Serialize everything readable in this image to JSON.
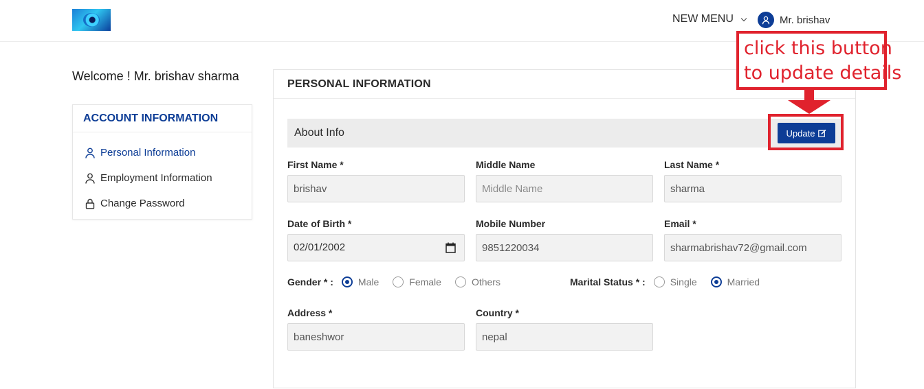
{
  "header": {
    "menu_label": "NEW MENU",
    "user_name": "Mr. brishav"
  },
  "annotation": {
    "line1": "click this button",
    "line2": "to update details",
    "color": "#e0222d"
  },
  "sidebar": {
    "welcome": "Welcome ! Mr. brishav sharma",
    "card_title": "ACCOUNT INFORMATION",
    "items": [
      {
        "label": "Personal Information",
        "icon": "user-icon",
        "active": true
      },
      {
        "label": "Employment Information",
        "icon": "user-icon",
        "active": false
      },
      {
        "label": "Change Password",
        "icon": "lock-icon",
        "active": false
      }
    ]
  },
  "panel": {
    "title": "PERSONAL INFORMATION",
    "section_title": "About Info",
    "update_label": "Update"
  },
  "form": {
    "first_name": {
      "label": "First Name *",
      "value": "brishav",
      "placeholder": "First Name"
    },
    "middle_name": {
      "label": "Middle Name",
      "value": "",
      "placeholder": "Middle Name"
    },
    "last_name": {
      "label": "Last Name *",
      "value": "sharma",
      "placeholder": "Last Name"
    },
    "dob": {
      "label": "Date of Birth *",
      "value": "02/01/2002"
    },
    "mobile": {
      "label": "Mobile Number",
      "value": "9851220034",
      "placeholder": "Mobile Number"
    },
    "email": {
      "label": "Email *",
      "value": "sharmabrishav72@gmail.com",
      "placeholder": "Email"
    },
    "gender": {
      "label": "Gender * :",
      "options": [
        "Male",
        "Female",
        "Others"
      ],
      "selected": "Male"
    },
    "marital": {
      "label": "Marital Status * :",
      "options": [
        "Single",
        "Married"
      ],
      "selected": "Married"
    },
    "address": {
      "label": "Address *",
      "value": "baneshwor",
      "placeholder": "Address"
    },
    "country": {
      "label": "Country *",
      "value": "nepal",
      "placeholder": "Country"
    }
  },
  "colors": {
    "primary": "#0d3d96",
    "annotation_red": "#e0222d",
    "input_bg": "#f2f2f2"
  }
}
